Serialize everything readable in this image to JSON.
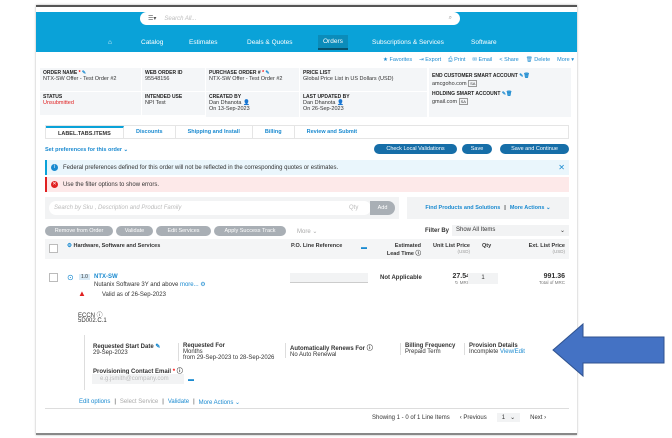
{
  "header": {
    "search_placeholder": "Search All...",
    "nav": [
      "Catalog",
      "Estimates",
      "Deals & Quotes",
      "Orders",
      "Subscriptions & Services",
      "Software"
    ]
  },
  "toolbar": [
    "Favorites",
    "Export",
    "Print",
    "Email",
    "Share",
    "Delete",
    "More"
  ],
  "order": {
    "order_name_label": "ORDER NAME",
    "order_name": "NTX-SW Offer - Test Order #2",
    "web_order_id_label": "WEB ORDER ID",
    "web_order_id": "95548156",
    "po_label": "PURCHASE ORDER #",
    "po": "NTX-SW Offer - Test Order #2",
    "price_list_label": "PRICE LIST",
    "price_list": "Global Price List in US Dollars (USD)",
    "status_label": "STATUS",
    "status": "Unsubmitted",
    "intended_use_label": "INTENDED USE",
    "intended_use": "NPI Test",
    "created_by_label": "CREATED BY",
    "created_by": "Dan Dhanota",
    "created_on": "On 13-Sep-2023",
    "updated_by_label": "LAST UPDATED BY",
    "updated_by": "Dan Dhanota",
    "updated_on": "On 26-Sep-2023",
    "end_customer_label": "END CUSTOMER SMART ACCOUNT",
    "end_customer": "amcgoho.com",
    "holding_label": "HOLDING SMART ACCOUNT",
    "holding": "gmail.com",
    "sa": "SA"
  },
  "tabs": [
    "LABEL.TABS.ITEMS",
    "Discounts",
    "Shipping and Install",
    "Billing",
    "Review and Submit"
  ],
  "prefs": "Set preferences for this order",
  "buttons": {
    "check": "Check Local Validations",
    "save": "Save",
    "save_continue": "Save and Continue"
  },
  "info_msg": "Federal preferences defined for this order will not be reflected in the corresponding quotes or estimates.",
  "error_msg": "Use the filter options to show errors.",
  "item_search": {
    "placeholder": "Search by Sku , Description and Product Family",
    "qty": "Qty",
    "add": "Add",
    "find": "Find Products and Solutions",
    "more_actions": "More Actions"
  },
  "actions": [
    "Remove from Order",
    "Validate",
    "Edit Services",
    "Apply Success Track",
    "More"
  ],
  "filter": {
    "label": "Filter By",
    "value": "Show All Items"
  },
  "columns": {
    "hw": "Hardware, Software and Services",
    "po": "P.O. Line Reference",
    "lead": "Estimated",
    "lead2": "Lead Time",
    "unit": "Unit List Price",
    "unit_cur": "(USD)",
    "qty": "Qty",
    "ext": "Ext. List Price",
    "ext_cur": "(USD)"
  },
  "line": {
    "num": "1.0",
    "sku": "NTX-SW",
    "desc": "Nutanix Software 3Y and above",
    "more": "more...",
    "valid": "Valid as of 26-Sep-2023",
    "lead": "Not Applicable",
    "unit": "27.54",
    "unit_sub": "MRC",
    "qty": "1",
    "ext": "991.36",
    "ext_sub": "Total of MRC",
    "eccn_label": "ECCN",
    "eccn": "5D002.C.1"
  },
  "details": {
    "start_label": "Requested Start Date",
    "start": "29-Sep-2023",
    "for_label": "Requested For",
    "for": "Months",
    "for_range": "from 29-Sep-2023 to 28-Sep-2026",
    "renew_label": "Automatically Renews For",
    "renew": "No Auto Renewal",
    "billing_label": "Billing Frequency",
    "billing": "Prepaid Term",
    "prov_label": "Provision Details",
    "prov": "Incomplete",
    "prov_link": "View/Edit",
    "email_label": "Provisioning Contact Email",
    "email_placeholder": "e.g.jsmith@company.com"
  },
  "footer_links": [
    "Edit options",
    "Select Service",
    "Validate",
    "More Actions"
  ],
  "pagination": {
    "showing": "Showing 1 - 0 of 1 Line Items",
    "prev": "Previous",
    "page": "1",
    "next": "Next"
  },
  "colors": {
    "header": "#0aa2d8",
    "button": "#166ea8",
    "arrow": "#4472c4",
    "error": "#e02020"
  }
}
